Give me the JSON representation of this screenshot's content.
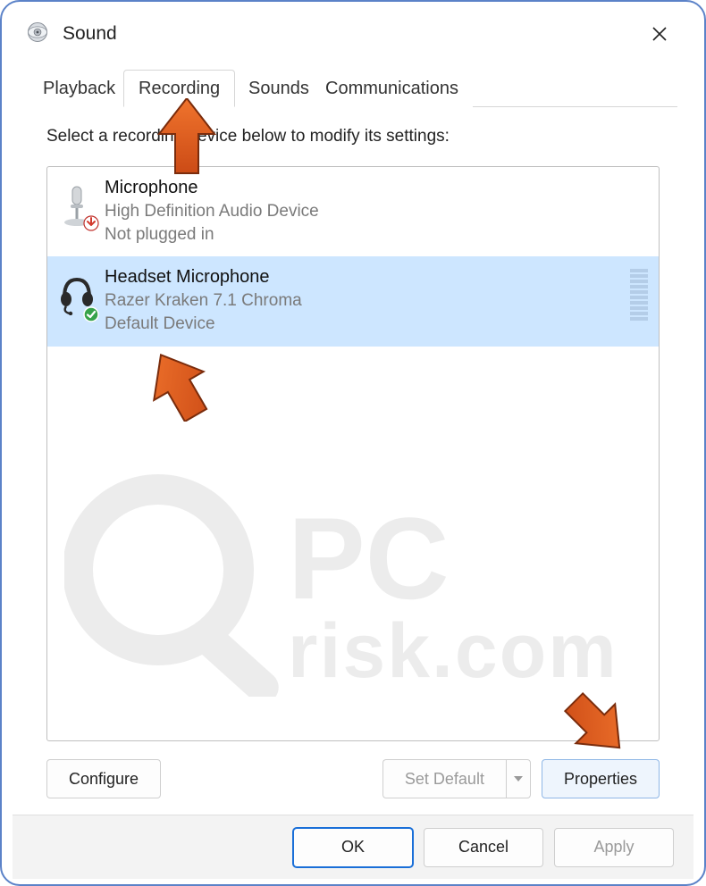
{
  "window": {
    "title": "Sound"
  },
  "tabs": [
    {
      "label": "Playback",
      "active": false
    },
    {
      "label": "Recording",
      "active": true
    },
    {
      "label": "Sounds",
      "active": false
    },
    {
      "label": "Communications",
      "active": false
    }
  ],
  "instruction": "Select a recording device below to modify its settings:",
  "devices": [
    {
      "name": "Microphone",
      "driver": "High Definition Audio Device",
      "status": "Not plugged in",
      "selected": false,
      "icon": "microphone",
      "badge": "unplugged"
    },
    {
      "name": "Headset Microphone",
      "driver": "Razer Kraken 7.1 Chroma",
      "status": "Default Device",
      "selected": true,
      "icon": "headset",
      "badge": "default",
      "level_bars": 10
    }
  ],
  "buttons": {
    "configure": "Configure",
    "set_default": "Set Default",
    "properties": "Properties"
  },
  "footer": {
    "ok": "OK",
    "cancel": "Cancel",
    "apply": "Apply"
  },
  "annotations": {
    "arrow_tab_recording": true,
    "arrow_device_selected": true,
    "arrow_properties": true
  },
  "watermark_text": "PCrisk.com"
}
